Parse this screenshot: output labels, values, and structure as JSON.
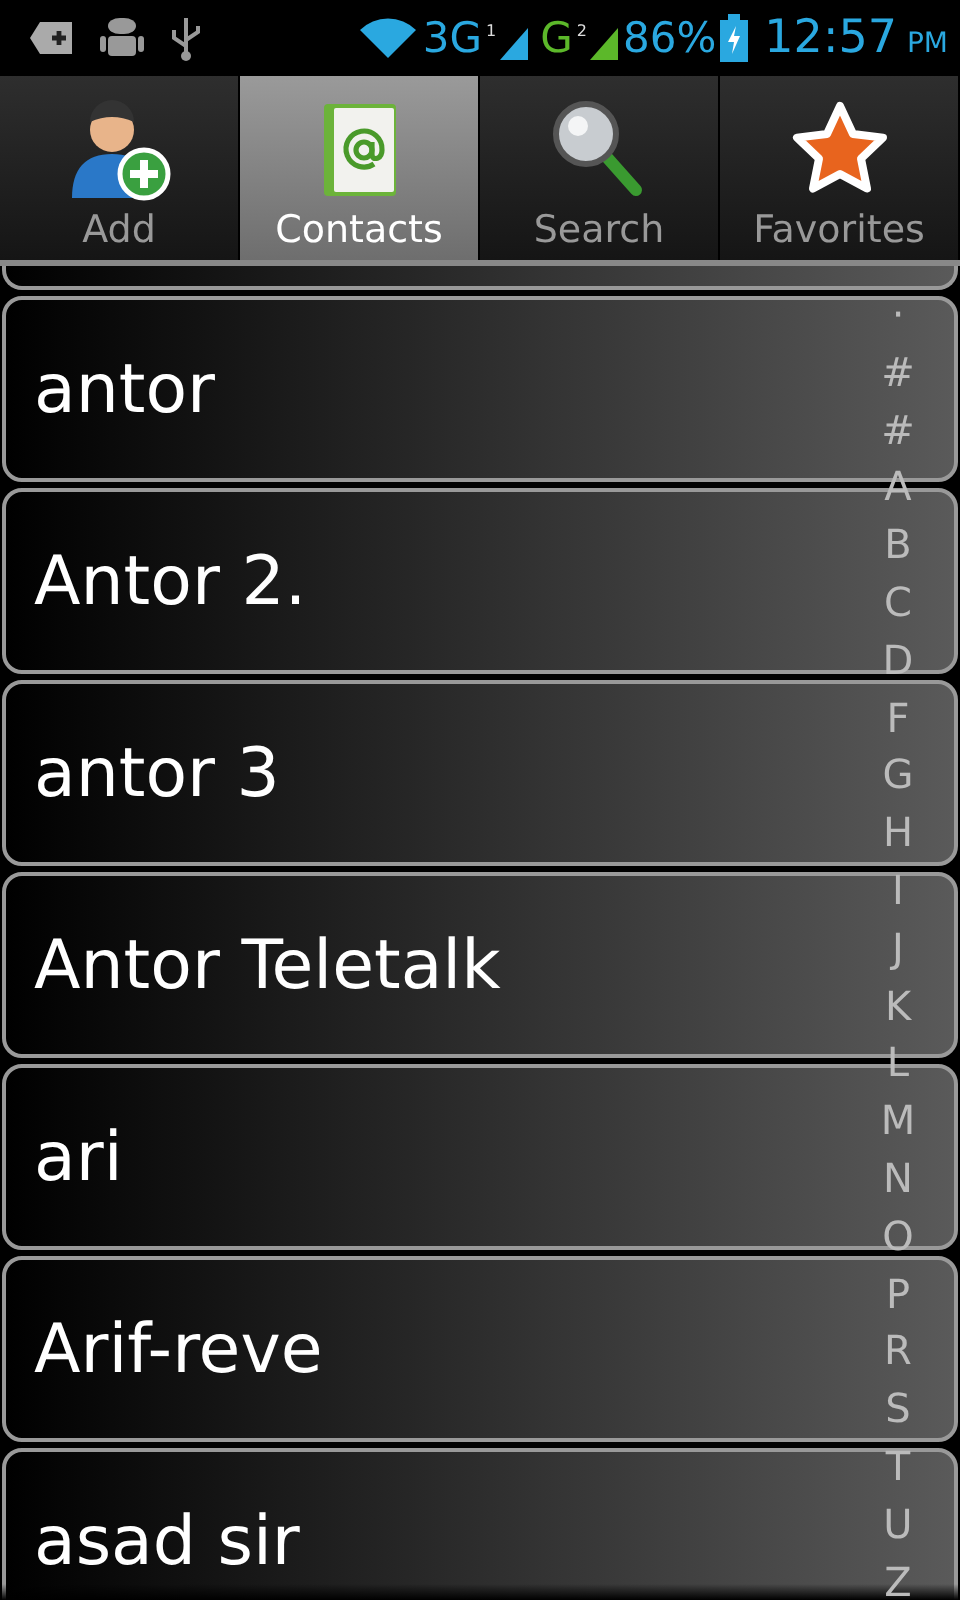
{
  "status_bar": {
    "network_1": "3G",
    "sim_1": "1",
    "network_2": "G",
    "sim_2": "2",
    "battery": "86%",
    "time": "12:57",
    "meridiem": "PM"
  },
  "tabs": [
    {
      "label": "Add",
      "kind": "add",
      "selected": false
    },
    {
      "label": "Contacts",
      "kind": "contacts",
      "selected": true
    },
    {
      "label": "Search",
      "kind": "search",
      "selected": false
    },
    {
      "label": "Favorites",
      "kind": "favorites",
      "selected": false
    }
  ],
  "contacts": [
    "antor",
    "Antor 2.",
    "antor 3",
    "Antor Teletalk",
    "ari",
    "Arif-reve",
    "asad sir"
  ],
  "index": [
    "·",
    "#",
    "#",
    "A",
    "B",
    "C",
    "D",
    "F",
    "G",
    "H",
    "I",
    "J",
    "K",
    "L",
    "M",
    "N",
    "O",
    "P",
    "R",
    "S",
    "T",
    "U",
    "Z"
  ]
}
